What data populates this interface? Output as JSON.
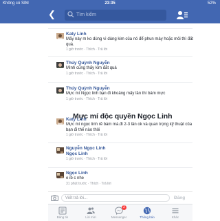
{
  "status_bar": {
    "carrier": "Không có SIM",
    "time": "23:35",
    "battery": "52%"
  },
  "header": {
    "search_placeholder": "Tìm kiếm"
  },
  "comments": [
    {
      "name": "Katy Linh",
      "text": "Mấy này m ko dùng vì dùng kim của nó để phun mày hoặc môi thì đất quá.",
      "meta": "1 giờ trước · Thích · Trả lời"
    },
    {
      "name": "Thúy Quỳnh Nguyễn",
      "text": "Mình cũng thấy kim đắt quá",
      "meta": "1 giờ trước · Thích · Trả lời"
    },
    {
      "name": "Thúy Quỳnh Nguyễn",
      "text": "Mực mí Ngọc linh bạn đi khoảng mấy lần thì bám mực",
      "meta": "1 giờ trước · Thích · Trả lời"
    },
    {
      "name": "Katy Linh",
      "text": "Mực mí ngọc linh rẽ bám mà.đi 2-3 lần ok và quan trọng kỹ thuật của bạn đi thế nào thôi",
      "meta": "1 giờ trước · Thích · Trả lời"
    },
    {
      "name": "Nguyễn Ngọc Linh",
      "text": "Ngọc Linh",
      "meta": "1 giờ trước · Thích · Trả lời"
    },
    {
      "name": "Ngọc Linh",
      "text": "e ib c nhe",
      "meta": "31 phút trước · Thích · Trả lời"
    }
  ],
  "overlay_banner": "Mực mí độc quyền Ngọc Linh",
  "composer": {
    "placeholder": "Viết trả lời...",
    "send_label": "Đăng"
  },
  "tabs": [
    {
      "label": "Bảng tin",
      "icon": "news-feed-icon"
    },
    {
      "label": "Lời mời",
      "icon": "friend-requests-icon"
    },
    {
      "label": "Messenger",
      "icon": "messenger-icon",
      "badge": "2"
    },
    {
      "label": "Thông báo",
      "icon": "globe-icon",
      "active": true
    },
    {
      "label": "Khác",
      "icon": "menu-icon"
    }
  ],
  "colors": {
    "brand_blue": "#4267b2",
    "name_blue": "#365899",
    "meta_gray": "#90949c",
    "badge_red": "#fa3e3e"
  }
}
